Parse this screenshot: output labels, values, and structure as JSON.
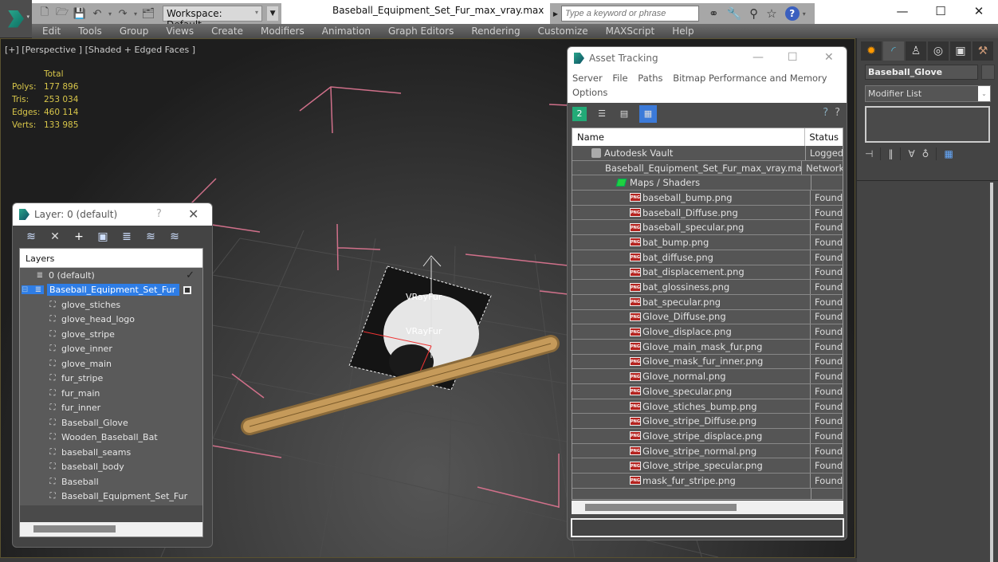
{
  "app": {
    "document_title": "Baseball_Equipment_Set_Fur_max_vray.max",
    "workspace_label": "Workspace: Default",
    "search_placeholder": "Type a keyword or phrase",
    "window_controls": [
      "—",
      "☐",
      "✕"
    ]
  },
  "menu": [
    "Edit",
    "Tools",
    "Group",
    "Views",
    "Create",
    "Modifiers",
    "Animation",
    "Graph Editors",
    "Rendering",
    "Customize",
    "MAXScript",
    "Help"
  ],
  "viewport": {
    "label": "[+] [Perspective ] [Shaded + Edged Faces ]",
    "stats_header": "Total",
    "stats": [
      {
        "key": "Polys:",
        "value": "177 896"
      },
      {
        "key": "Tris:",
        "value": "253 034"
      },
      {
        "key": "Edges:",
        "value": "460 114"
      },
      {
        "key": "Verts:",
        "value": "133 985"
      }
    ],
    "fur_labels": [
      "VRayFur",
      "VRayFur"
    ]
  },
  "layer_dialog": {
    "title": "Layer: 0 (default)",
    "help": "?",
    "close": "✕",
    "column_header": "Layers",
    "rows": [
      {
        "label": "0 (default)",
        "type": "layer",
        "indent": 1,
        "active": true
      },
      {
        "label": "Baseball_Equipment_Set_Fur",
        "type": "layer",
        "indent": 1,
        "selected": true
      },
      {
        "label": "glove_stiches",
        "type": "object",
        "indent": 2
      },
      {
        "label": "glove_head_logo",
        "type": "object",
        "indent": 2
      },
      {
        "label": "glove_stripe",
        "type": "object",
        "indent": 2
      },
      {
        "label": "glove_inner",
        "type": "object",
        "indent": 2
      },
      {
        "label": "glove_main",
        "type": "object",
        "indent": 2
      },
      {
        "label": "fur_stripe",
        "type": "object",
        "indent": 2
      },
      {
        "label": "fur_main",
        "type": "object",
        "indent": 2
      },
      {
        "label": "fur_inner",
        "type": "object",
        "indent": 2
      },
      {
        "label": "Baseball_Glove",
        "type": "object",
        "indent": 2
      },
      {
        "label": "Wooden_Baseball_Bat",
        "type": "object",
        "indent": 2
      },
      {
        "label": "baseball_seams",
        "type": "object",
        "indent": 2
      },
      {
        "label": "baseball_body",
        "type": "object",
        "indent": 2
      },
      {
        "label": "Baseball",
        "type": "object",
        "indent": 2
      },
      {
        "label": "Baseball_Equipment_Set_Fur",
        "type": "object",
        "indent": 2
      }
    ]
  },
  "asset_tracking": {
    "title": "Asset Tracking",
    "menu": [
      "Server",
      "File",
      "Paths",
      "Bitmap Performance and Memory",
      "Options"
    ],
    "columns": [
      "Name",
      "Status"
    ],
    "rows": [
      {
        "name": "Autodesk Vault",
        "status": "Logged",
        "icon": "vault",
        "indent": 1
      },
      {
        "name": "Baseball_Equipment_Set_Fur_max_vray.max",
        "status": "Network",
        "icon": "max",
        "indent": 2
      },
      {
        "name": "Maps / Shaders",
        "status": "",
        "icon": "maps",
        "indent": 3
      },
      {
        "name": "baseball_bump.png",
        "status": "Found",
        "icon": "png",
        "indent": 4
      },
      {
        "name": "baseball_Diffuse.png",
        "status": "Found",
        "icon": "png",
        "indent": 4
      },
      {
        "name": "baseball_specular.png",
        "status": "Found",
        "icon": "png",
        "indent": 4
      },
      {
        "name": "bat_bump.png",
        "status": "Found",
        "icon": "png",
        "indent": 4
      },
      {
        "name": "bat_diffuse.png",
        "status": "Found",
        "icon": "png",
        "indent": 4
      },
      {
        "name": "bat_displacement.png",
        "status": "Found",
        "icon": "png",
        "indent": 4
      },
      {
        "name": "bat_glossiness.png",
        "status": "Found",
        "icon": "png",
        "indent": 4
      },
      {
        "name": "bat_specular.png",
        "status": "Found",
        "icon": "png",
        "indent": 4
      },
      {
        "name": "Glove_Diffuse.png",
        "status": "Found",
        "icon": "png",
        "indent": 4
      },
      {
        "name": "Glove_displace.png",
        "status": "Found",
        "icon": "png",
        "indent": 4
      },
      {
        "name": "Glove_main_mask_fur.png",
        "status": "Found",
        "icon": "png",
        "indent": 4
      },
      {
        "name": "Glove_mask_fur_inner.png",
        "status": "Found",
        "icon": "png",
        "indent": 4
      },
      {
        "name": "Glove_normal.png",
        "status": "Found",
        "icon": "png",
        "indent": 4
      },
      {
        "name": "Glove_specular.png",
        "status": "Found",
        "icon": "png",
        "indent": 4
      },
      {
        "name": "Glove_stiches_bump.png",
        "status": "Found",
        "icon": "png",
        "indent": 4
      },
      {
        "name": "Glove_stripe_Diffuse.png",
        "status": "Found",
        "icon": "png",
        "indent": 4
      },
      {
        "name": "Glove_stripe_displace.png",
        "status": "Found",
        "icon": "png",
        "indent": 4
      },
      {
        "name": "Glove_stripe_normal.png",
        "status": "Found",
        "icon": "png",
        "indent": 4
      },
      {
        "name": "Glove_stripe_specular.png",
        "status": "Found",
        "icon": "png",
        "indent": 4
      },
      {
        "name": "mask_fur_stripe.png",
        "status": "Found",
        "icon": "png",
        "indent": 4
      },
      {
        "name": "",
        "status": "",
        "icon": "",
        "indent": 0
      }
    ]
  },
  "command_panel": {
    "object_name": "Baseball_Glove",
    "modifier_list": "Modifier List"
  },
  "colors": {
    "accent": "#2e7de6",
    "stats_text": "#d8c64a",
    "png_icon": "#b5231f"
  }
}
